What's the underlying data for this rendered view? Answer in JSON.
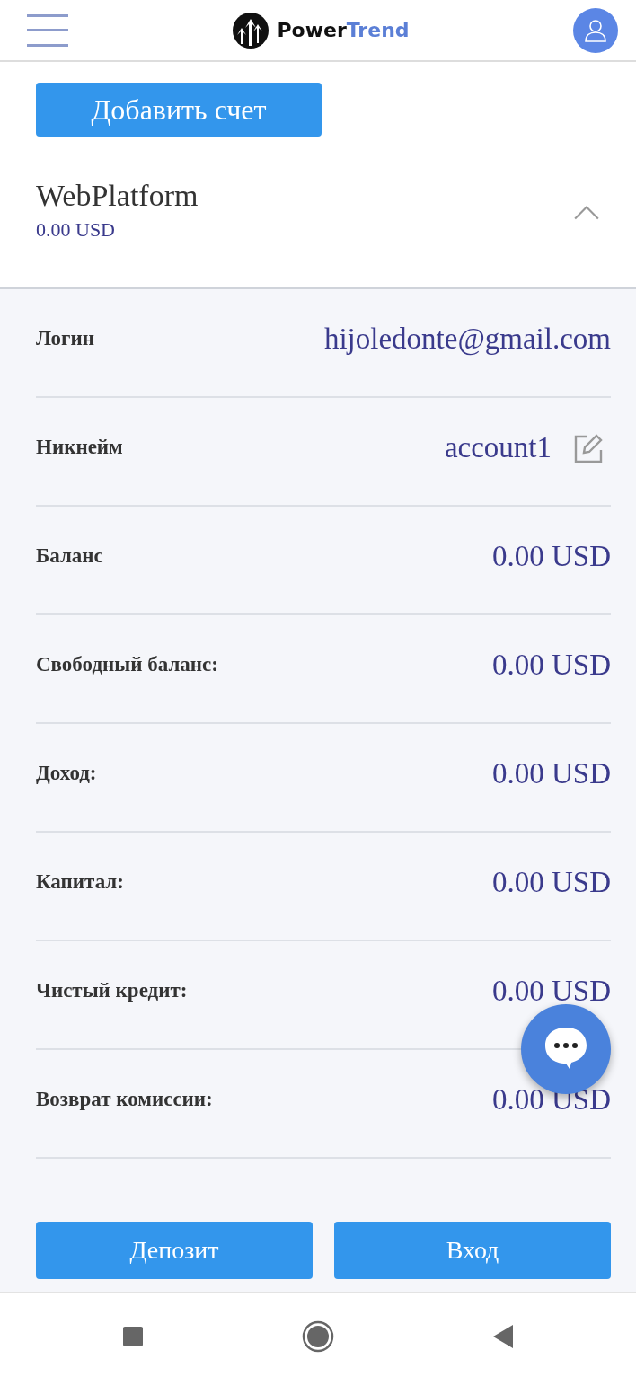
{
  "header": {
    "brand_first": "Power",
    "brand_second": "Trend"
  },
  "add_account_button": "Добавить счет",
  "account": {
    "name": "WebPlatform",
    "balance": "0.00 USD",
    "expanded": true,
    "rows": [
      {
        "label": "Логин",
        "value": "hijoledonte@gmail.com",
        "kind": "plain"
      },
      {
        "label": "Никнейм",
        "value": "account1",
        "kind": "editable"
      },
      {
        "label": "Баланс",
        "value": "0.00 USD",
        "kind": "plain"
      },
      {
        "label": "Свободный баланс:",
        "value": "0.00 USD",
        "kind": "plain"
      },
      {
        "label": "Доход:",
        "value": "0.00 USD",
        "kind": "plain"
      },
      {
        "label": "Капитал:",
        "value": "0.00 USD",
        "kind": "plain"
      },
      {
        "label": "Чистый кредит:",
        "value": "0.00 USD",
        "kind": "plain"
      },
      {
        "label": "Возврат комиссии:",
        "value": "0.00 USD",
        "kind": "plain"
      }
    ],
    "buttons": [
      "Депозит",
      "Вход"
    ]
  }
}
